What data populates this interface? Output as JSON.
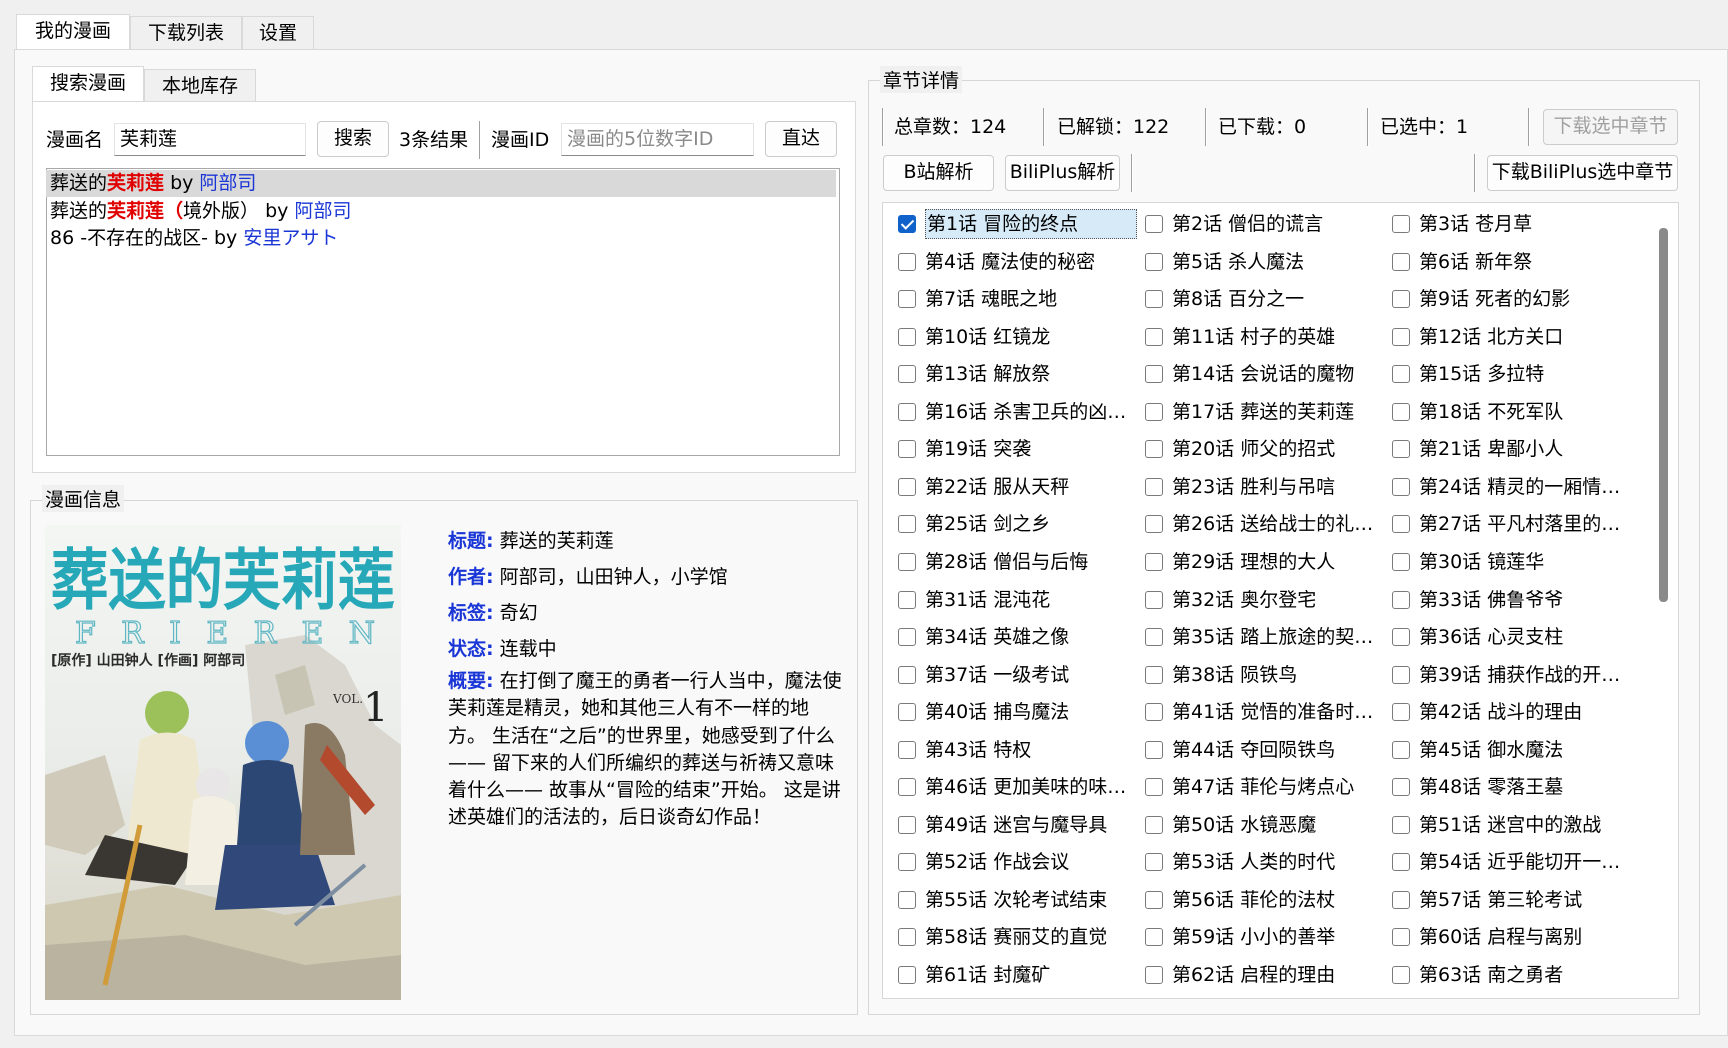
{
  "tabs": {
    "items": [
      "我的漫画",
      "下载列表",
      "设置"
    ],
    "active": 0
  },
  "left": {
    "subtabs": [
      "搜索漫画",
      "本地库存"
    ],
    "search": {
      "name_label": "漫画名",
      "name_value": "芙莉莲",
      "search_button": "搜索",
      "result_count": "3条结果",
      "id_label": "漫画ID",
      "id_placeholder": "漫画的5位数字ID",
      "go_button": "直达"
    },
    "results": [
      {
        "pre": "葬送的",
        "hl": "芙莉莲",
        "post": "",
        "by": " by ",
        "author": "阿部司"
      },
      {
        "pre": "葬送的",
        "hl": "芙莉莲（",
        "post": "境外版）",
        "by": " by ",
        "author": "阿部司"
      },
      {
        "pre": "86 -不存在的战区-",
        "hl": "",
        "post": "",
        "by": " by ",
        "author": "安里アサト"
      }
    ],
    "info": {
      "group_title": "漫画信息",
      "title_label": "标题:",
      "title": "葬送的芙莉莲",
      "author_label": "作者:",
      "author": "阿部司，山田钟人，小学馆",
      "tags_label": "标签:",
      "tags": "奇幻",
      "status_label": "状态:",
      "status": "连载中",
      "summary_label": "概要:",
      "summary": "在打倒了魔王的勇者一行人当中，魔法使芙莉莲是精灵，她和其他三人有不一样的地方。 生活在“之后”的世界里，她感受到了什么—— 留下来的人们所编织的葬送与祈祷又意味着什么—— 故事从“冒险的结束”开始。 这是讲述英雄们的活法的，后日谈奇幻作品！",
      "cover": {
        "title_text": "葬送的芙莉莲",
        "latin": "FRIEREN",
        "credits": "[原作] 山田钟人  [作画] 阿部司",
        "vol": "VOL.",
        "vol_num": "1"
      }
    }
  },
  "right": {
    "group_title": "章节详情",
    "stats": {
      "total": "总章数：124",
      "unlocked": "已解锁：122",
      "downloaded": "已下载：0",
      "selected": "已选中：1"
    },
    "buttons": {
      "download_selected": "下载选中章节",
      "bili_parse": "B站解析",
      "biliplus_parse": "BiliPlus解析",
      "download_biliplus": "下载BiliPlus选中章节"
    },
    "chapters": [
      {
        "label": "第1话 冒险的终点",
        "checked": true
      },
      {
        "label": "第2话 僧侣的谎言"
      },
      {
        "label": "第3话 苍月草"
      },
      {
        "label": "第4话 魔法使的秘密"
      },
      {
        "label": "第5话 杀人魔法"
      },
      {
        "label": "第6话 新年祭"
      },
      {
        "label": "第7话 魂眠之地"
      },
      {
        "label": "第8话 百分之一"
      },
      {
        "label": "第9话 死者的幻影"
      },
      {
        "label": "第10话 红镜龙"
      },
      {
        "label": "第11话 村子的英雄"
      },
      {
        "label": "第12话 北方关口"
      },
      {
        "label": "第13话 解放祭"
      },
      {
        "label": "第14话 会说话的魔物"
      },
      {
        "label": "第15话 多拉特"
      },
      {
        "label": "第16话 杀害卫兵的凶…"
      },
      {
        "label": "第17话 葬送的芙莉莲"
      },
      {
        "label": "第18话 不死军队"
      },
      {
        "label": "第19话 突袭"
      },
      {
        "label": "第20话 师父的招式"
      },
      {
        "label": "第21话 卑鄙小人"
      },
      {
        "label": "第22话 服从天秤"
      },
      {
        "label": "第23话 胜利与吊唁"
      },
      {
        "label": "第24话 精灵的一厢情…"
      },
      {
        "label": "第25话 剑之乡"
      },
      {
        "label": "第26话 送给战士的礼…"
      },
      {
        "label": "第27话 平凡村落里的…"
      },
      {
        "label": "第28话 僧侣与后悔"
      },
      {
        "label": "第29话 理想的大人"
      },
      {
        "label": "第30话 镜莲华"
      },
      {
        "label": "第31话 混沌花"
      },
      {
        "label": "第32话 奥尔登宅"
      },
      {
        "label": "第33话 佛鲁爷爷"
      },
      {
        "label": "第34话 英雄之像"
      },
      {
        "label": "第35话 踏上旅途的契…"
      },
      {
        "label": "第36话 心灵支柱"
      },
      {
        "label": "第37话 一级考试"
      },
      {
        "label": "第38话 陨铁鸟"
      },
      {
        "label": "第39话 捕获作战的开…"
      },
      {
        "label": "第40话 捕鸟魔法"
      },
      {
        "label": "第41话 觉悟的准备时…"
      },
      {
        "label": "第42话 战斗的理由"
      },
      {
        "label": "第43话 特权"
      },
      {
        "label": "第44话 夺回陨铁鸟"
      },
      {
        "label": "第45话 御水魔法"
      },
      {
        "label": "第46话 更加美味的味…"
      },
      {
        "label": "第47话 菲伦与烤点心"
      },
      {
        "label": "第48话 零落王墓"
      },
      {
        "label": "第49话 迷宫与魔导具"
      },
      {
        "label": "第50话 水镜恶魔"
      },
      {
        "label": "第51话 迷宫中的激战"
      },
      {
        "label": "第52话 作战会议"
      },
      {
        "label": "第53话 人类的时代"
      },
      {
        "label": "第54话 近乎能切开一…"
      },
      {
        "label": "第55话 次轮考试结束"
      },
      {
        "label": "第56话 菲伦的法杖"
      },
      {
        "label": "第57话 第三轮考试"
      },
      {
        "label": "第58话 赛丽艾的直觉"
      },
      {
        "label": "第59话 小小的善举"
      },
      {
        "label": "第60话 启程与离别"
      },
      {
        "label": "第61话 封魔矿"
      },
      {
        "label": "第62话 启程的理由"
      },
      {
        "label": "第63话 南之勇者"
      }
    ]
  }
}
